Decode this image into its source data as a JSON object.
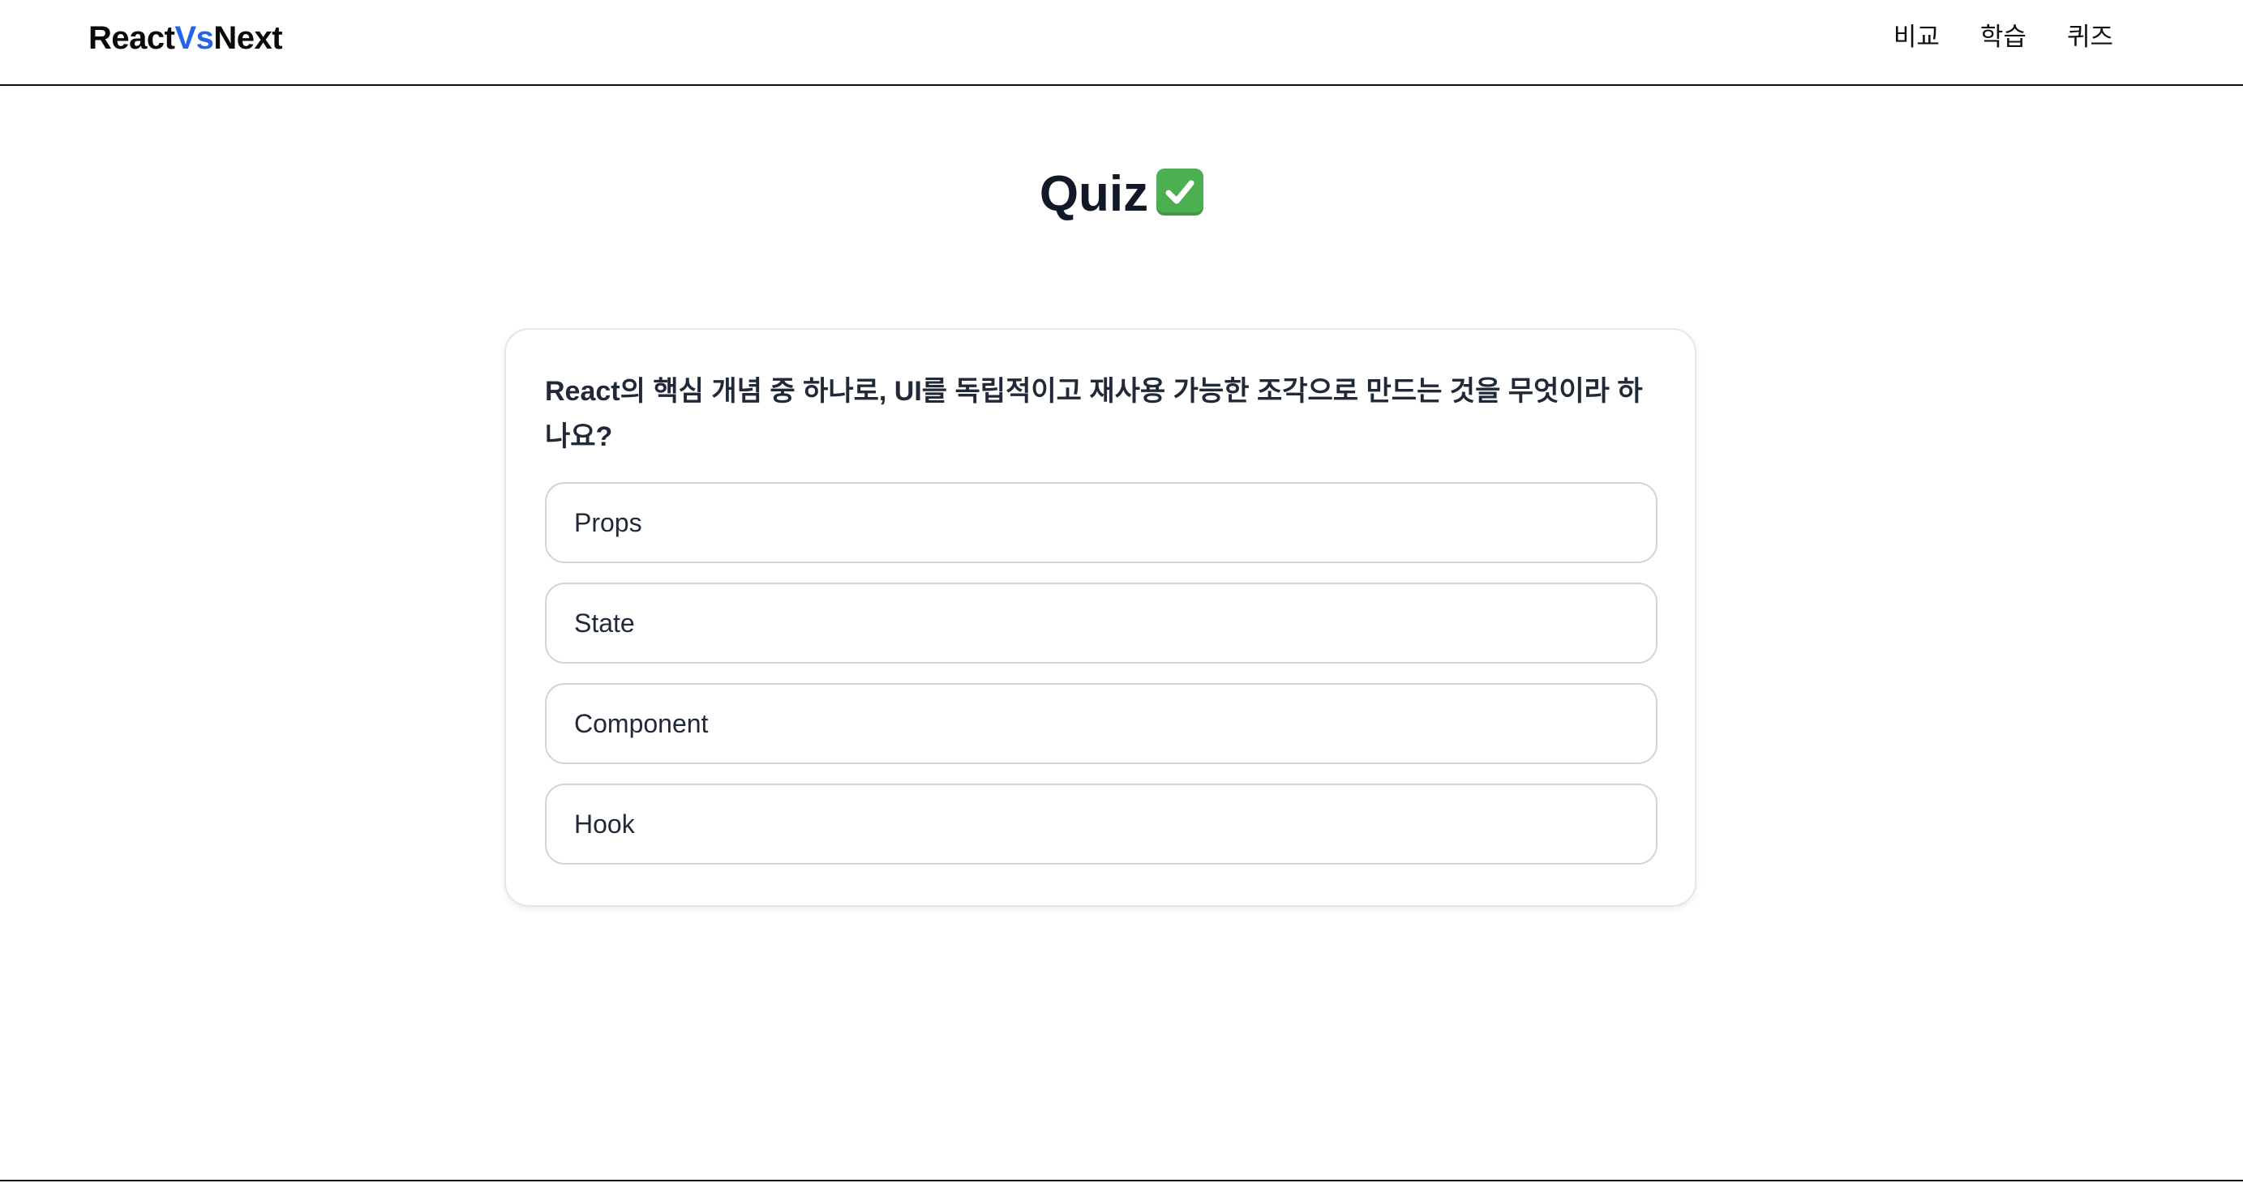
{
  "header": {
    "logo_part1": "React",
    "logo_part2": "Vs",
    "logo_part3": "Next",
    "nav": [
      {
        "label": "비교"
      },
      {
        "label": "학습"
      },
      {
        "label": "퀴즈"
      }
    ]
  },
  "page": {
    "title": "Quiz",
    "title_icon": "check-mark-button-icon"
  },
  "quiz": {
    "question": "React의 핵심 개념 중 하나로, UI를 독립적이고 재사용 가능한 조각으로 만드는 것을 무엇이라 하나요?",
    "options": [
      {
        "label": "Props"
      },
      {
        "label": "State"
      },
      {
        "label": "Component"
      },
      {
        "label": "Hook"
      }
    ]
  },
  "colors": {
    "accent": "#2563eb",
    "check_green": "#4caf50"
  }
}
